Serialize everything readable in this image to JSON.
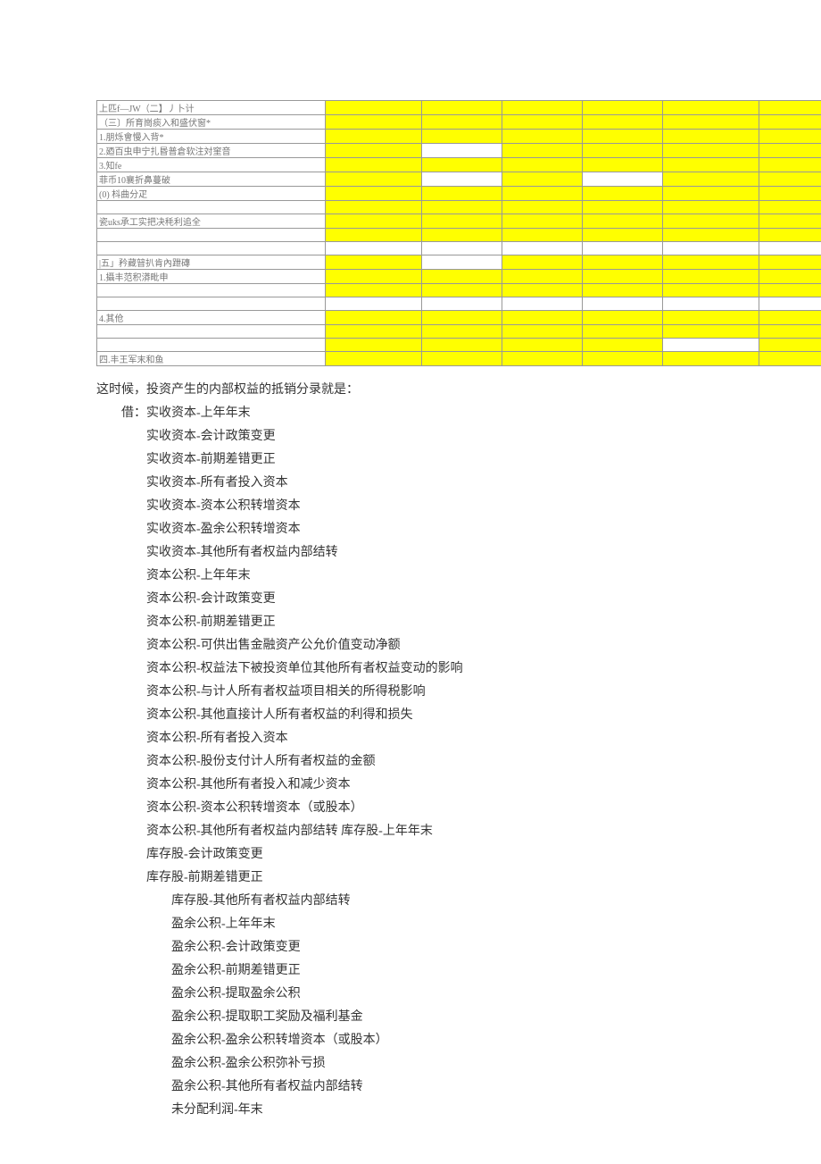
{
  "table": {
    "rows": [
      {
        "label": "上匹f—JW（二】丿卜计",
        "pattern": "y6"
      },
      {
        "label": "（三〕所育崗痰入和盛伏窗*",
        "pattern": "y6"
      },
      {
        "label": "1.朋烁會慢入背*",
        "pattern": "y6"
      },
      {
        "label": "2.廼百虫申宁扎昬普倉软注対窐音",
        "pattern": "y1w1y4"
      },
      {
        "label": "3.知fe",
        "pattern": "y6"
      },
      {
        "label": "菲币10襄折鼻蔓破",
        "pattern": "y1w1y1w1y2"
      },
      {
        "label": "   (0) 枓曲分疋",
        "pattern": "y6"
      },
      {
        "label": "",
        "pattern": "y6"
      },
      {
        "label": "瓷uks承工实把决秏利追全",
        "pattern": "y6"
      },
      {
        "label": "",
        "pattern": "y6"
      },
      {
        "label": "",
        "pattern": "w6"
      },
      {
        "label": "|五」矜藏暜扒肯內跇磚",
        "pattern": "y1w1y4"
      },
      {
        "label": "1.攝丰范积漭毗申",
        "pattern": "y6"
      },
      {
        "label": "",
        "pattern": "y6"
      },
      {
        "label": "",
        "pattern": "w6"
      },
      {
        "label": "4.其伧",
        "pattern": "y6"
      },
      {
        "label": "",
        "pattern": "y6"
      },
      {
        "label": "",
        "pattern": "y4w1y1"
      },
      {
        "label": "四.丰王军末和鱼",
        "pattern": "y6"
      }
    ]
  },
  "intro": "这时候，投资产生的内部权益的抵销分录就是：",
  "lines": [
    {
      "indent": 1,
      "text": "借：实收资本-上年年末"
    },
    {
      "indent": 2,
      "text": "实收资本-会计政策变更"
    },
    {
      "indent": 2,
      "text": "实收资本-前期差错更正"
    },
    {
      "indent": 2,
      "text": "实收资本-所有者投入资本"
    },
    {
      "indent": 2,
      "text": "实收资本-资本公积转增资本"
    },
    {
      "indent": 2,
      "text": "实收资本-盈余公积转增资本"
    },
    {
      "indent": 2,
      "text": "实收资本-其他所有者权益内部结转"
    },
    {
      "indent": 2,
      "text": "资本公积-上年年末"
    },
    {
      "indent": 2,
      "text": "资本公积-会计政策变更"
    },
    {
      "indent": 2,
      "text": "资本公积-前期差错更正"
    },
    {
      "indent": 2,
      "text": "资本公积-可供出售金融资产公允价值变动净额"
    },
    {
      "indent": 2,
      "text": "资本公积-权益法下被投资单位其他所有者权益变动的影响"
    },
    {
      "indent": 2,
      "text": "资本公积-与计人所有者权益项目相关的所得税影响"
    },
    {
      "indent": 2,
      "text": "资本公积-其他直接计人所有者权益的利得和损失"
    },
    {
      "indent": 2,
      "text": "资本公积-所有者投入资本"
    },
    {
      "indent": 2,
      "text": "资本公积-股份支付计人所有者权益的金额"
    },
    {
      "indent": 2,
      "text": "资本公积-其他所有者投入和减少资本"
    },
    {
      "indent": 2,
      "text": "资本公积-资本公积转增资本（或股本）"
    },
    {
      "indent": 2,
      "text": "资本公积-其他所有者权益内部结转  库存股-上年年末"
    },
    {
      "indent": 2,
      "text": "库存股-会计政策变更"
    },
    {
      "indent": 2,
      "text": "库存股-前期差错更正"
    },
    {
      "indent": 3,
      "text": "库存股-其他所有者权益内部结转"
    },
    {
      "indent": 3,
      "text": "盈余公积-上年年末"
    },
    {
      "indent": 3,
      "text": "盈余公积-会计政策变更"
    },
    {
      "indent": 3,
      "text": "盈余公积-前期差错更正"
    },
    {
      "indent": 3,
      "text": "盈余公积-提取盈余公积"
    },
    {
      "indent": 3,
      "text": "盈余公积-提取职工奖励及福利基金"
    },
    {
      "indent": 3,
      "text": "盈余公积-盈余公积转增资本（或股本）"
    },
    {
      "indent": 3,
      "text": "盈余公积-盈余公积弥补亏损"
    },
    {
      "indent": 3,
      "text": "盈余公积-其他所有者权益内部结转"
    },
    {
      "indent": 3,
      "text": "未分配利润-年末"
    }
  ]
}
